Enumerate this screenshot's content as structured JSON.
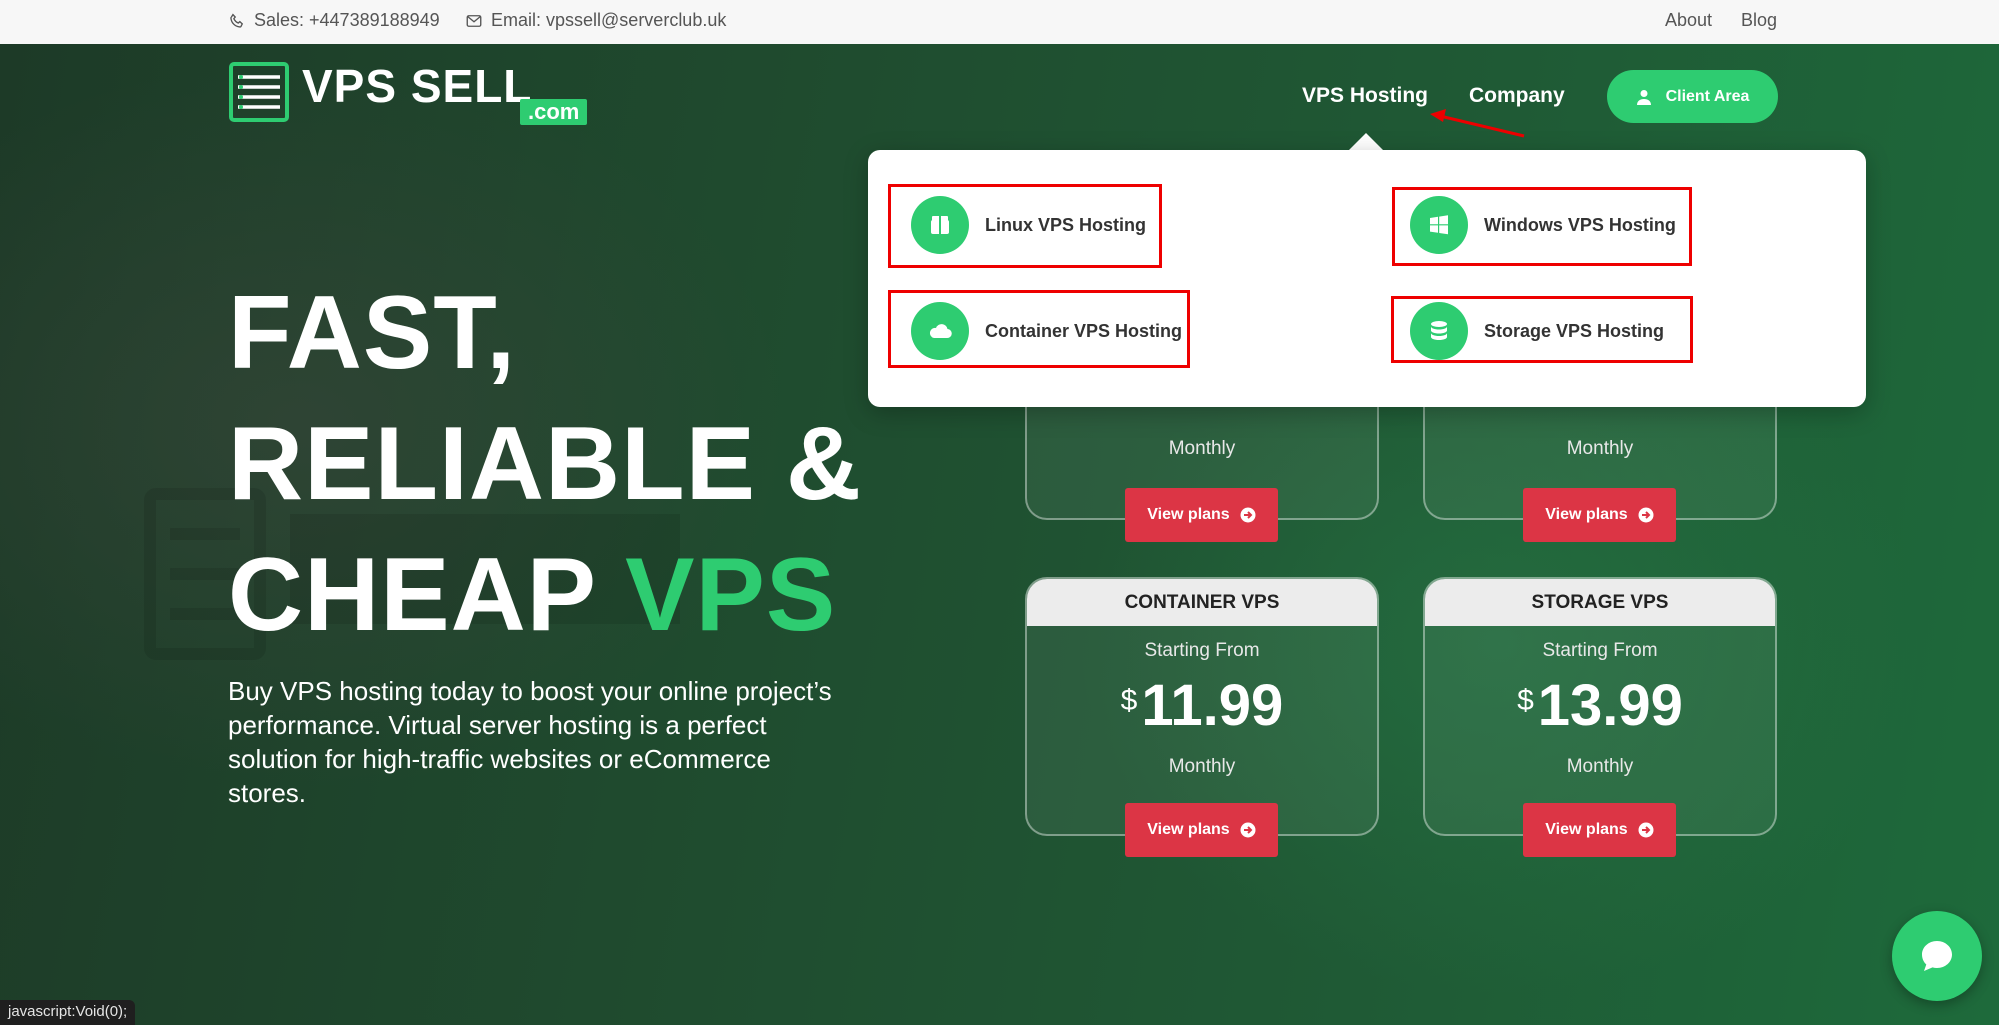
{
  "topbar": {
    "sales": "Sales: +447389188949",
    "email": "Email: vpssell@serverclub.uk",
    "about": "About",
    "blog": "Blog"
  },
  "logo": {
    "main": "VPS SELL",
    "suffix": ".com"
  },
  "nav": {
    "vps_hosting": "VPS Hosting",
    "company": "Company",
    "client_area": "Client Area"
  },
  "hero": {
    "line1": "FAST,",
    "line2": "RELIABLE &",
    "line3_plain": "CHEAP ",
    "line3_accent": "VPS",
    "subtext": "Buy VPS hosting today to boost your online project’s performance. Virtual server hosting is a perfect solution for high-traffic websites or eCommerce stores."
  },
  "dropdown": {
    "items": [
      {
        "label": "Linux VPS Hosting",
        "icon": "box-icon"
      },
      {
        "label": "Windows VPS Hosting",
        "icon": "windows-icon"
      },
      {
        "label": "Container VPS Hosting",
        "icon": "cloud-icon"
      },
      {
        "label": "Storage VPS Hosting",
        "icon": "database-icon"
      }
    ]
  },
  "cards": {
    "top_left_monthly": "Monthly",
    "top_right_monthly": "Monthly",
    "top_left_button": "View plans",
    "top_right_button": "View plans",
    "container": {
      "title": "CONTAINER VPS",
      "from": "Starting From",
      "currency": "$",
      "price": "11.99",
      "period": "Monthly",
      "button": "View plans"
    },
    "storage": {
      "title": "STORAGE VPS",
      "from": "Starting From",
      "currency": "$",
      "price": "13.99",
      "period": "Monthly",
      "button": "View plans"
    }
  },
  "status_bar": "javascript:Void(0);",
  "colors": {
    "accent": "#2ecc71",
    "button_red": "#dc3545",
    "annotation_red": "#ee0000"
  }
}
